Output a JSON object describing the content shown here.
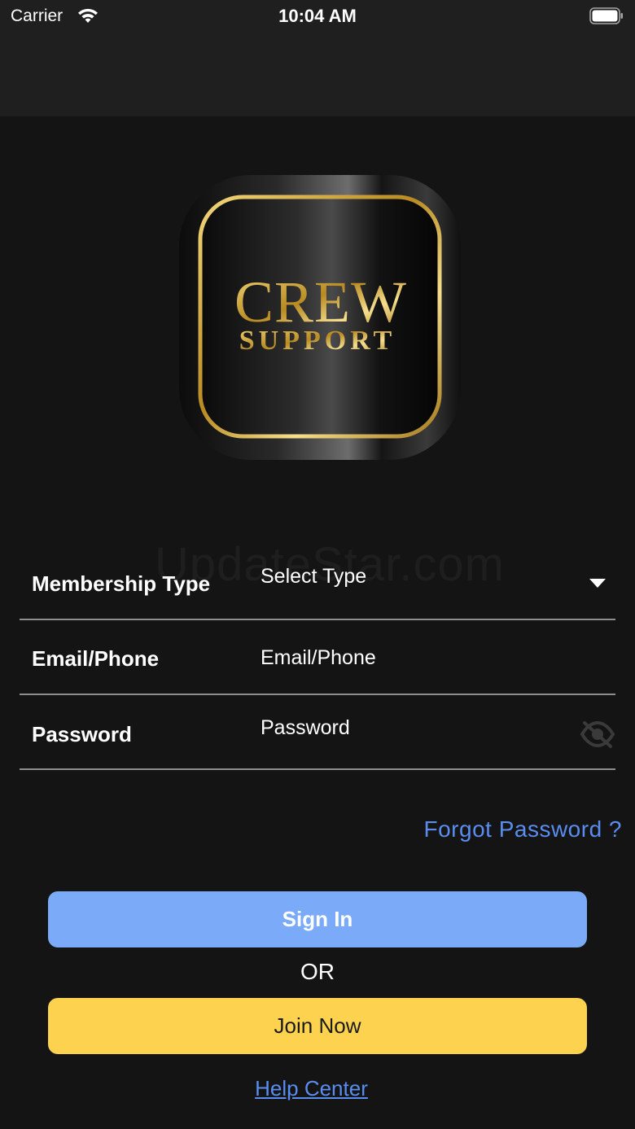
{
  "status_bar": {
    "carrier": "Carrier",
    "time": "10:04 AM"
  },
  "logo": {
    "line1": "CREW",
    "line2": "SUPPORT",
    "gold": "#d9b24a"
  },
  "watermark": "UpdateStar.com",
  "form": {
    "membership": {
      "label": "Membership Type",
      "value": "Select Type"
    },
    "email": {
      "label": "Email/Phone",
      "placeholder": "Email/Phone"
    },
    "password": {
      "label": "Password",
      "placeholder": "Password"
    }
  },
  "forgot_password": "Forgot Password ?",
  "buttons": {
    "sign_in": "Sign In",
    "or": "OR",
    "join_now": "Join Now"
  },
  "help_center": "Help Center",
  "colors": {
    "background": "#141414",
    "link": "#5a8df0",
    "sign_in_bg": "#7aaaf8",
    "join_bg": "#fdd24f"
  }
}
